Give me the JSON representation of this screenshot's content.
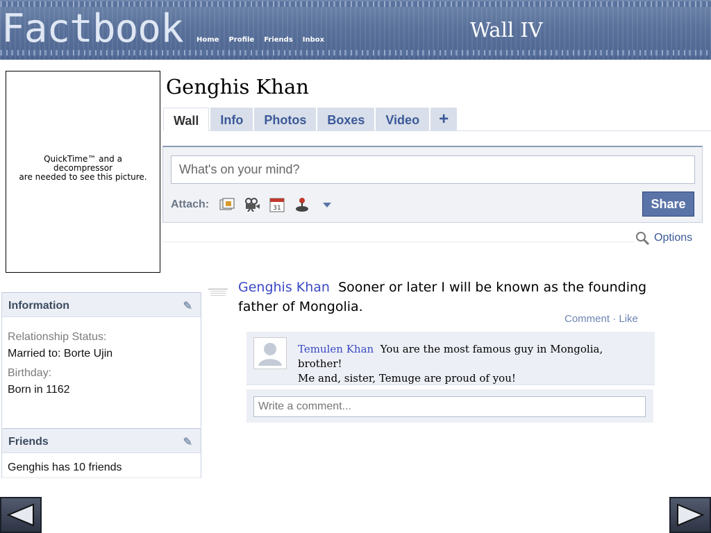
{
  "header": {
    "logo": "Factbook",
    "nav": [
      "Home",
      "Profile",
      "Friends",
      "Inbox"
    ],
    "slide_title": "Wall IV"
  },
  "media_placeholder": {
    "line1": "QuickTime™ and a",
    "line2": "decompressor",
    "line3": "are needed to see this picture."
  },
  "profile": {
    "name": "Genghis Khan",
    "tabs": [
      "Wall",
      "Info",
      "Photos",
      "Boxes",
      "Video",
      "+"
    ],
    "active_tab": "Wall"
  },
  "composer": {
    "placeholder": "What's on your mind?",
    "attach_label": "Attach:",
    "attach_icons": [
      "photo-icon",
      "video-camera-icon",
      "calendar-icon",
      "joystick-icon",
      "dropdown-arrow-icon"
    ],
    "calendar_day": "31",
    "share_label": "Share",
    "options_label": "Options"
  },
  "sidebar": {
    "information": {
      "heading": "Information",
      "relationship_label": "Relationship Status:",
      "relationship_value": "Married to: Borte Ujin",
      "birthday_label": "Birthday:",
      "birthday_value": "Born in 1162"
    },
    "friends": {
      "heading": "Friends",
      "summary": "Genghis has 10 friends"
    }
  },
  "post": {
    "author": "Genghis Khan",
    "text": "Sooner or later I will be known as the founding father of Mongolia.",
    "comment_label": "Comment",
    "separator": "·",
    "like_label": "Like"
  },
  "comments": [
    {
      "author": "Temulen Khan",
      "text": "You are the most famous guy in Mongolia, brother!",
      "text2": "Me and, sister, Temuge are proud of you!"
    }
  ],
  "write_comment_placeholder": "Write a comment...",
  "colors": {
    "link_blue": "#3b5998",
    "author_blue": "#3b48c4",
    "share_button": "#5b74a8",
    "banner": "#5a729b"
  }
}
